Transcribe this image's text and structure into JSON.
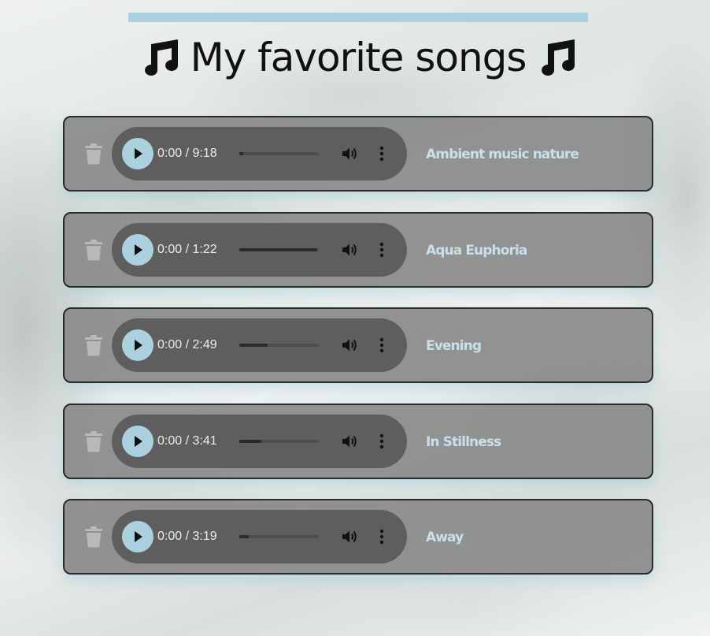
{
  "page": {
    "title": "My favorite songs",
    "left_icon": "music-note-icon",
    "right_icon": "music-note-icon"
  },
  "colors": {
    "accent": "#acd1de",
    "card_bg": "#8a8a8a",
    "player_bg": "#5e5e5e",
    "title_text": "#c9e0e8"
  },
  "songs": [
    {
      "title": "Ambient music nature",
      "current_time": "0:00",
      "duration": "9:18",
      "progress": 0.05
    },
    {
      "title": "Aqua Euphoria",
      "current_time": "0:00",
      "duration": "1:22",
      "progress": 0.98
    },
    {
      "title": "Evening",
      "current_time": "0:00",
      "duration": "2:49",
      "progress": 0.36
    },
    {
      "title": "In Stillness",
      "current_time": "0:00",
      "duration": "3:41",
      "progress": 0.28
    },
    {
      "title": "Away",
      "current_time": "0:00",
      "duration": "3:19",
      "progress": 0.12
    }
  ],
  "player": {
    "time_separator": "/",
    "play_icon": "play-icon",
    "volume_icon": "volume-icon",
    "menu_icon": "more-options-icon",
    "delete_icon": "trash-icon"
  }
}
